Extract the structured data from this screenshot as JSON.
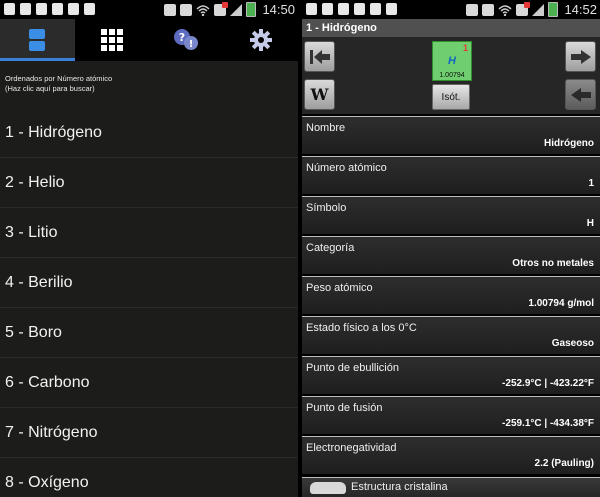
{
  "left": {
    "status": {
      "time": "14:50"
    },
    "tabs": [
      {
        "name": "list",
        "icon": "list-icon"
      },
      {
        "name": "grid",
        "icon": "grid-icon"
      },
      {
        "name": "help",
        "icon": "help-icon"
      },
      {
        "name": "settings",
        "icon": "gear-icon"
      }
    ],
    "sort_line1": "Ordenados por Número atómico",
    "sort_line2": "(Haz clic aquí para buscar)",
    "elements": [
      "1 - Hidrógeno",
      "2 - Helio",
      "3 - Litio",
      "4 - Berilio",
      "5 - Boro",
      "6 - Carbono",
      "7 - Nitrógeno",
      "8 - Oxígeno"
    ]
  },
  "right": {
    "status": {
      "time": "14:52"
    },
    "title": "1 - Hidrógeno",
    "tile": {
      "number": "1",
      "symbol": "H",
      "weight": "1.00794"
    },
    "wiki_label": "W",
    "isotopes_label": "Isót.",
    "properties": [
      {
        "label": "Nombre",
        "value": "Hidrógeno"
      },
      {
        "label": "Número atómico",
        "value": "1"
      },
      {
        "label": "Símbolo",
        "value": "H"
      },
      {
        "label": "Categoría",
        "value": "Otros no metales"
      },
      {
        "label": "Peso atómico",
        "value": "1.00794 g/mol"
      },
      {
        "label": "Estado físico a los 0°C",
        "value": "Gaseoso"
      },
      {
        "label": "Punto de ebullición",
        "value": "-252.9°C | -423.22°F"
      },
      {
        "label": "Punto de fusión",
        "value": "-259.1°C | -434.38°F"
      },
      {
        "label": "Electronegatividad",
        "value": "2.2 (Pauling)"
      }
    ],
    "crystal_label": "Estructura cristalina"
  }
}
